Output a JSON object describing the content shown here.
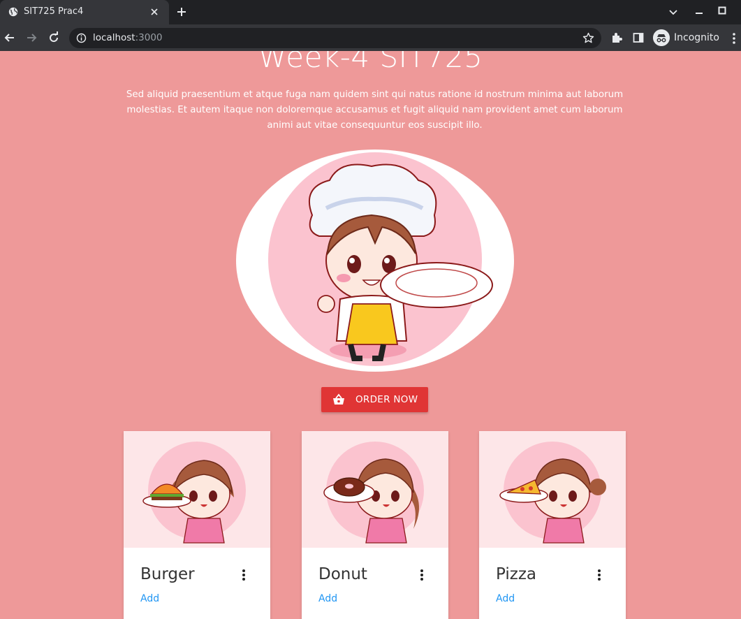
{
  "browser": {
    "tab_title": "SIT725 Prac4",
    "url_host": "localhost",
    "url_port": ":3000",
    "incognito_label": "Incognito"
  },
  "page": {
    "heading": "Week-4 SIT725",
    "lead": "Sed aliquid praesentium et atque fuga nam quidem sint qui natus ratione id nostrum minima aut laborum molestias. Et autem itaque non doloremque accusamus et fugit aliquid nam provident amet cum laborum animi aut vitae consequuntur eos suscipit illo.",
    "order_button": "ORDER NOW",
    "cards": [
      {
        "name": "Burger",
        "action": "Add",
        "food_icon": "burger"
      },
      {
        "name": "Donut",
        "action": "Add",
        "food_icon": "donut"
      },
      {
        "name": "Pizza",
        "action": "Add",
        "food_icon": "pizza"
      }
    ]
  },
  "colors": {
    "page_background": "#ee9999",
    "accent_button": "#e03535",
    "link": "#2196f3"
  }
}
